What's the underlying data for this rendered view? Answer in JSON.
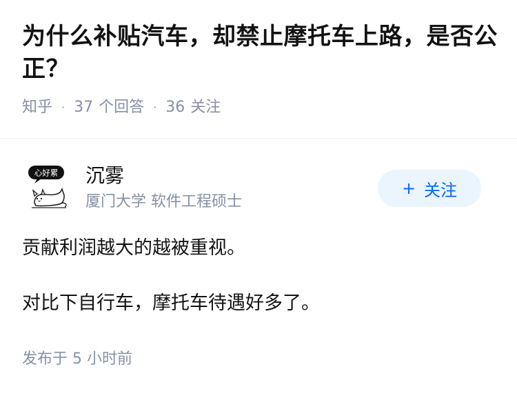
{
  "question": {
    "title": "为什么补贴汽车，却禁止摩托车上路，是否公正？",
    "source": "知乎",
    "answer_count": "37",
    "answer_label": "个回答",
    "follow_count": "36",
    "follow_label": "关注"
  },
  "author": {
    "name": "沉雾",
    "description": "厦门大学 软件工程硕士",
    "avatar_icon": "cat-avatar-icon",
    "avatar_caption": "心好累",
    "follow_button": {
      "plus": "+",
      "label": "关注",
      "bg_color": "#ebf5fd",
      "text_color": "#0066ff"
    }
  },
  "answer": {
    "paragraphs": [
      "贡献利润越大的越被重视。",
      "对比下自行车，摩托车待遇好多了。"
    ],
    "publish_time": "发布于 5 小时前"
  },
  "colors": {
    "primary_text": "#121212",
    "secondary_text": "#8590a6",
    "accent": "#0066ff"
  }
}
